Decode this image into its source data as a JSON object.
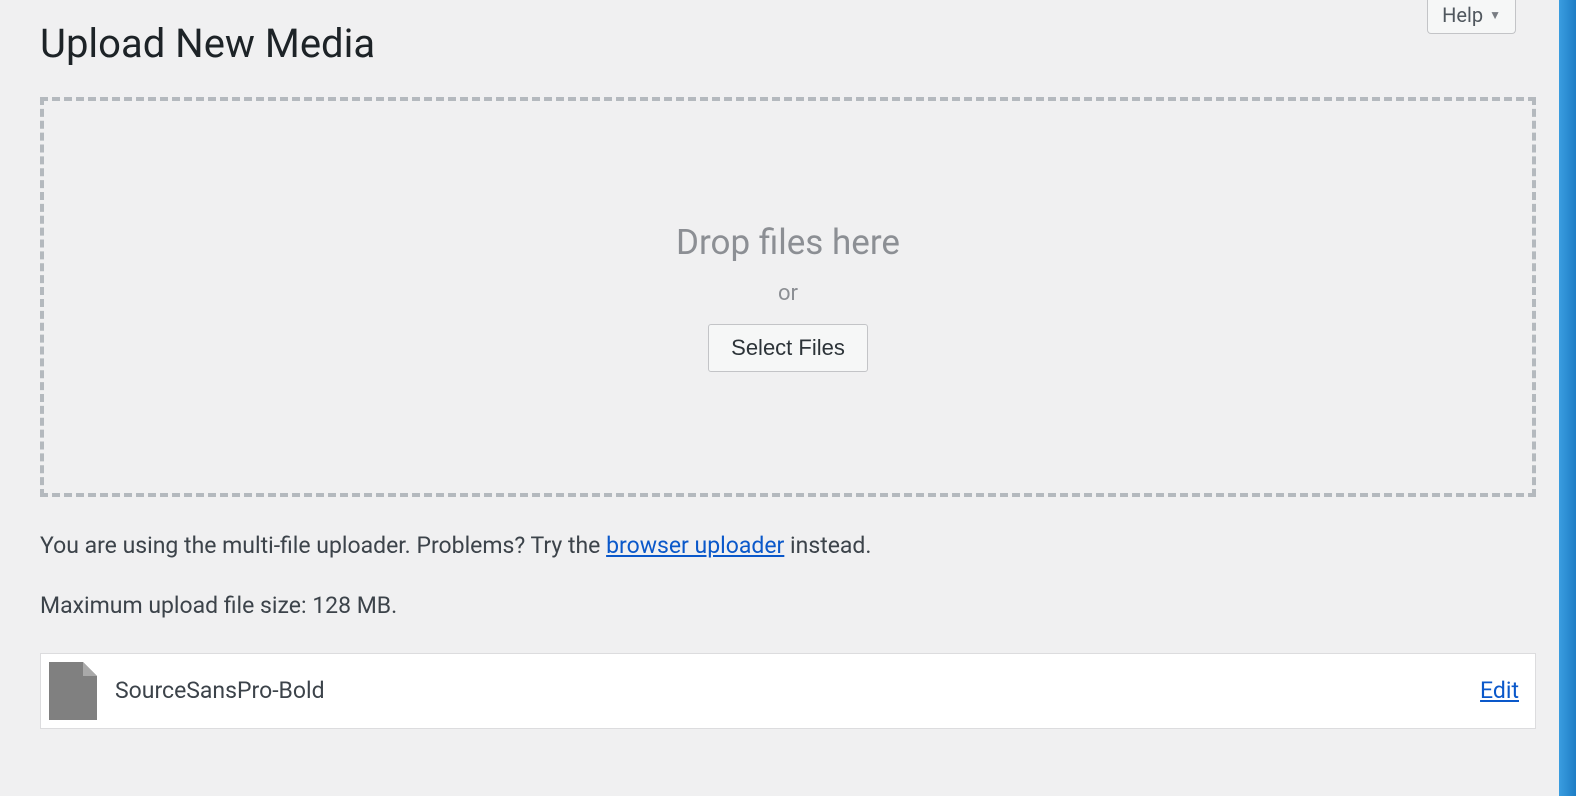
{
  "header": {
    "help_label": "Help"
  },
  "page": {
    "title": "Upload New Media"
  },
  "dropzone": {
    "drop_text": "Drop files here",
    "or_text": "or",
    "select_button": "Select Files"
  },
  "info": {
    "prefix": "You are using the multi-file uploader. Problems? Try the ",
    "link_text": "browser uploader",
    "suffix": " instead."
  },
  "limits": {
    "max_size_text": "Maximum upload file size: 128 MB."
  },
  "media_items": [
    {
      "filename": "SourceSansPro-Bold",
      "edit_label": "Edit"
    }
  ]
}
